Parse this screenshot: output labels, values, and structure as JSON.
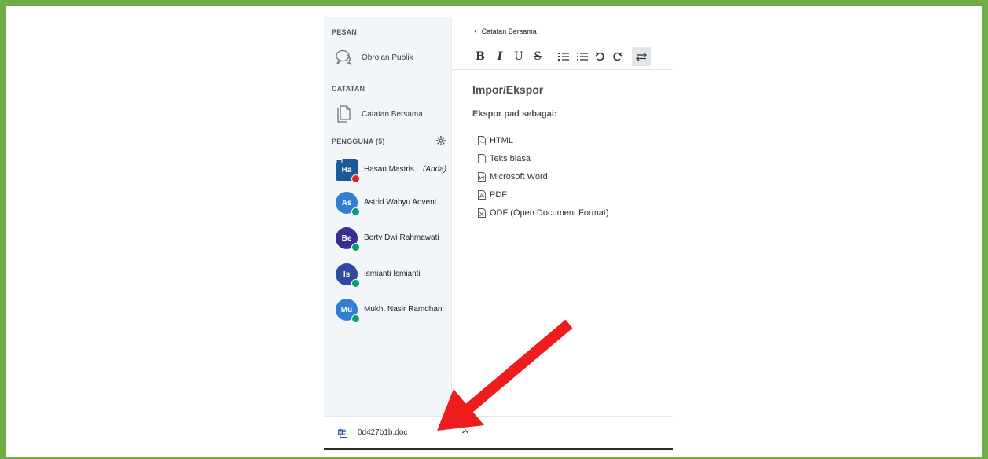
{
  "sidebar": {
    "messages_label": "PESAN",
    "public_chat": "Obrolan Publik",
    "notes_label": "CATATAN",
    "shared_notes": "Catatan Bersama",
    "users_label": "PENGGUNA (5)",
    "users": [
      {
        "initials": "Ha",
        "name": "Hasan Mastris...",
        "you_tag": "(Anda)",
        "color": "#1a5a9a",
        "status": "red",
        "presenter": true
      },
      {
        "initials": "As",
        "name": "Astrid Wahyu Advent...",
        "you_tag": "",
        "color": "#2f80d3",
        "status": "green",
        "presenter": false
      },
      {
        "initials": "Be",
        "name": "Berty Dwi Rahmawati",
        "you_tag": "",
        "color": "#3b2d8f",
        "status": "green",
        "presenter": false
      },
      {
        "initials": "Is",
        "name": "Ismianti Ismianti",
        "you_tag": "",
        "color": "#2e4aa3",
        "status": "green",
        "presenter": false
      },
      {
        "initials": "Mu",
        "name": "Mukh. Nasir Ramdhani",
        "you_tag": "",
        "color": "#2f80d3",
        "status": "green",
        "presenter": false
      }
    ]
  },
  "panel": {
    "back_label": "Catatan Bersama",
    "heading": "Impor/Ekspor",
    "subheading": "Ekspor pad sebagai:",
    "exports": [
      "HTML",
      "Teks biasa",
      "Microsoft Word",
      "PDF",
      "ODF (Open Document Format)"
    ]
  },
  "toolbar": {
    "bold": "B",
    "italic": "I",
    "underline": "U",
    "strike": "S"
  },
  "download": {
    "filename": "0d427b1b.doc"
  },
  "colors": {
    "frame": "#70ad47",
    "arrow": "#ee1c1c"
  }
}
